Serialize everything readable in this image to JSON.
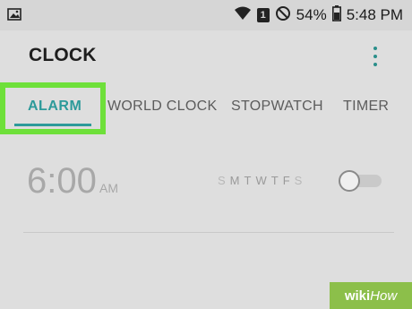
{
  "status_bar": {
    "battery": "54%",
    "sim": "1",
    "time": "5:48 PM",
    "icons": [
      "image-icon",
      "wifi-icon",
      "sim-icon",
      "do-not-disturb-icon",
      "battery-icon"
    ]
  },
  "app": {
    "title": "CLOCK"
  },
  "tabs": [
    {
      "label": "ALARM",
      "active": true
    },
    {
      "label": "WORLD CLOCK",
      "active": false
    },
    {
      "label": "STOPWATCH",
      "active": false
    },
    {
      "label": "TIMER",
      "active": false
    }
  ],
  "highlight_color": "#6ee03a",
  "accent_color": "#2d9a9a",
  "alarm": {
    "time": "6:00",
    "ampm": "AM",
    "days": [
      "S",
      "M",
      "T",
      "W",
      "T",
      "F",
      "S"
    ],
    "enabled": false
  },
  "watermark": {
    "wiki": "wiki",
    "how": "How"
  }
}
